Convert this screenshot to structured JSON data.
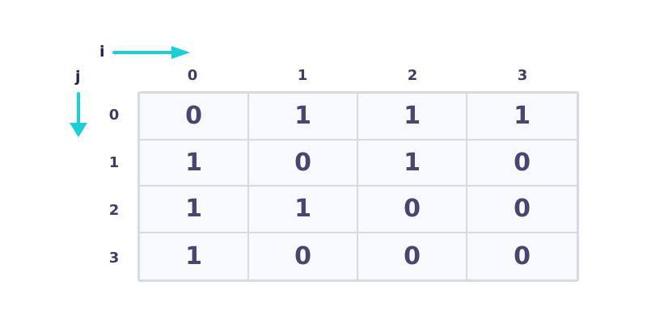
{
  "axes": {
    "i_label": "i",
    "j_label": "j"
  },
  "column_headers": [
    "0",
    "1",
    "2",
    "3"
  ],
  "row_headers": [
    "0",
    "1",
    "2",
    "3"
  ],
  "matrix": [
    [
      "0",
      "1",
      "1",
      "1"
    ],
    [
      "1",
      "0",
      "1",
      "0"
    ],
    [
      "1",
      "1",
      "0",
      "0"
    ],
    [
      "1",
      "0",
      "0",
      "0"
    ]
  ],
  "colors": {
    "arrow": "#1ccfd6",
    "text": "#464670",
    "grid": "#d5dbe3",
    "cell_background": "#f8f9fc"
  }
}
